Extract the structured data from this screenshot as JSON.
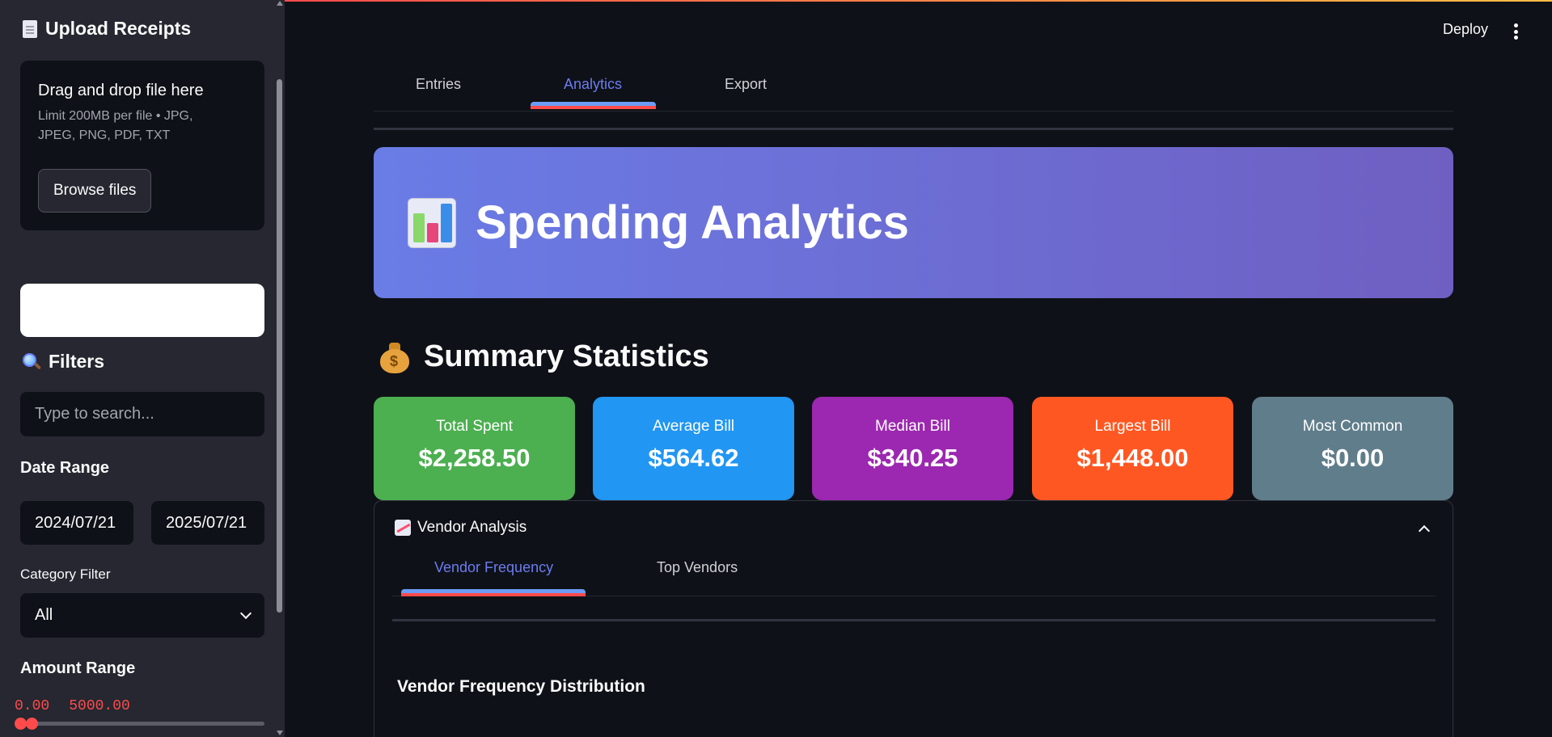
{
  "colors": {
    "accent_red": "#ff4b4b",
    "tab_active": "#6c7cf0",
    "card_total": "#4caf50",
    "card_average": "#2196f3",
    "card_median": "#9c27b0",
    "card_largest": "#ff5722",
    "card_common": "#607d8b"
  },
  "sidebar": {
    "upload_title": "Upload Receipts",
    "upload_icon": "page-document-icon",
    "dropzone": {
      "title": "Drag and drop file here",
      "subtitle": "Limit 200MB per file • JPG, JPEG, PNG, PDF, TXT",
      "browse_label": "Browse files"
    },
    "filters_title": "Filters",
    "filters_icon": "magnifier-icon",
    "search_placeholder": "Type to search...",
    "date_range_label": "Date Range",
    "date_start": "2024/07/21",
    "date_end": "2025/07/21",
    "category_label": "Category Filter",
    "category_value": "All",
    "amount_label": "Amount Range",
    "amount_min": "0.00",
    "amount_max": "5000.00"
  },
  "header": {
    "deploy_label": "Deploy"
  },
  "tabs": [
    {
      "label": "Entries"
    },
    {
      "label": "Analytics",
      "active": true
    },
    {
      "label": "Export"
    }
  ],
  "hero": {
    "title": "Spending Analytics",
    "icon": "bar-chart-icon"
  },
  "summary": {
    "title": "Summary Statistics",
    "icon": "money-bag-icon",
    "cards": [
      {
        "label": "Total Spent",
        "value": "$2,258.50"
      },
      {
        "label": "Average Bill",
        "value": "$564.62"
      },
      {
        "label": "Median Bill",
        "value": "$340.25"
      },
      {
        "label": "Largest Bill",
        "value": "$1,448.00"
      },
      {
        "label": "Most Common",
        "value": "$0.00"
      }
    ]
  },
  "vendor_analysis": {
    "title": "Vendor Analysis",
    "icon": "chart-increasing-icon",
    "subtabs": [
      {
        "label": "Vendor Frequency",
        "active": true
      },
      {
        "label": "Top Vendors"
      }
    ],
    "section_title": "Vendor Frequency Distribution"
  }
}
